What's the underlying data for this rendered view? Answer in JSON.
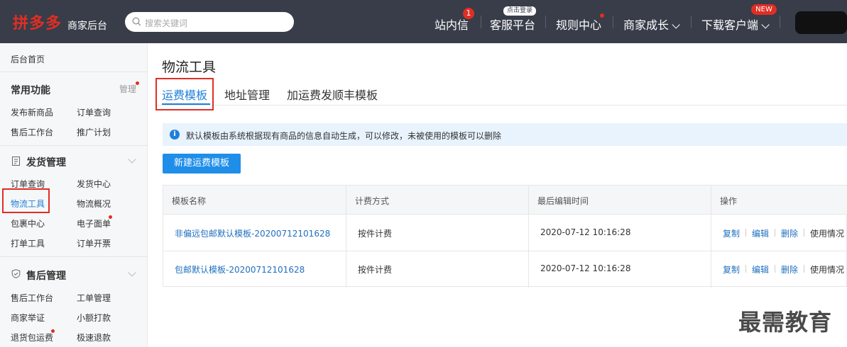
{
  "header": {
    "logo": "拼多多",
    "logo_sub": "商家后台",
    "search_placeholder": "搜索关键词",
    "nav": {
      "inbox": "站内信",
      "inbox_badge": "1",
      "service": "客服平台",
      "service_bubble": "点击登录",
      "rules": "规则中心",
      "growth": "商家成长",
      "download": "下载客户端",
      "new_badge": "NEW"
    }
  },
  "sidebar": {
    "home": "后台首页",
    "common": {
      "title": "常用功能",
      "manage": "管理",
      "items": [
        "发布新商品",
        "订单查询",
        "售后工作台",
        "推广计划"
      ]
    },
    "shipping": {
      "title": "发货管理",
      "items": [
        "订单查询",
        "发货中心",
        "物流工具",
        "物流概况",
        "包裹中心",
        "电子面单",
        "打单工具",
        "订单开票"
      ]
    },
    "aftersale": {
      "title": "售后管理",
      "items": [
        "售后工作台",
        "工单管理",
        "商家举证",
        "小额打款",
        "退货包运费",
        "极速退款"
      ]
    }
  },
  "main": {
    "title": "物流工具",
    "tabs": [
      "运费模板",
      "地址管理",
      "加运费发顺丰模板"
    ],
    "notice": "默认模板由系统根据现有商品的信息自动生成，可以修改，未被使用的模板可以删除",
    "new_button": "新建运费模板",
    "table": {
      "headers": [
        "模板名称",
        "计费方式",
        "最后编辑时间",
        "操作"
      ],
      "rows": [
        {
          "name": "非偏远包邮默认模板-20200712101628",
          "method": "按件计费",
          "time": "2020-07-12 10:16:28"
        },
        {
          "name": "包邮默认模板-20200712101628",
          "method": "按件计费",
          "time": "2020-07-12 10:16:28"
        }
      ],
      "ops": [
        "复制",
        "编辑",
        "删除",
        "使用情况"
      ]
    }
  },
  "watermark": "最需教育",
  "colors": {
    "header_bg": "#383d49",
    "brand_red": "#e02e24",
    "link_blue": "#1f7fd9",
    "button_blue": "#1f8ee9",
    "notice_bg": "#e8f3fd"
  }
}
